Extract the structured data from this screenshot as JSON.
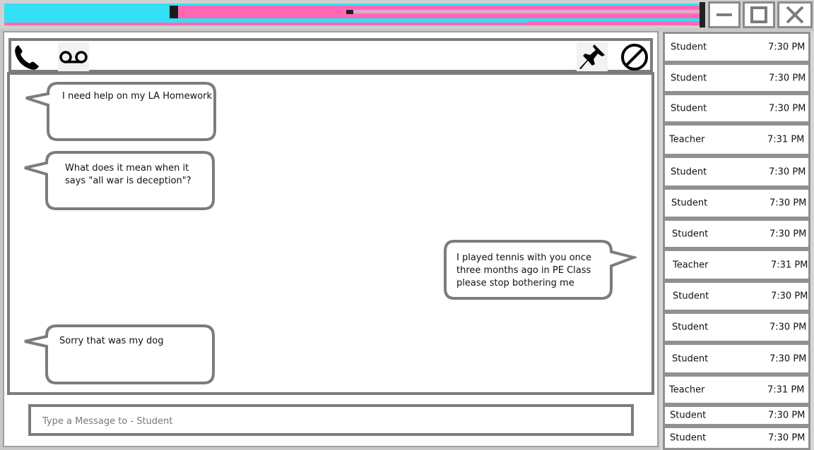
{
  "window": {
    "colors": {
      "cyan": "#33e0f5",
      "pink": "#ff69b4",
      "border": "#7c7c7c"
    },
    "controls": {
      "minimize_icon": "minimize-icon",
      "maximize_icon": "maximize-icon",
      "close_icon": "close-icon"
    }
  },
  "toolbar": {
    "left_icons": [
      "phone-icon",
      "voicemail-icon"
    ],
    "right_icons": [
      "pin-icon",
      "block-icon"
    ]
  },
  "messages": [
    {
      "side": "left",
      "text": "I need help on my LA Homework"
    },
    {
      "side": "left",
      "text": "What does it mean when it\nsays \"all war is deception\"?"
    },
    {
      "side": "right",
      "text": "I played tennis with you once\nthree months ago in PE Class\nplease stop bothering me"
    },
    {
      "side": "left",
      "text": "Sorry that was my dog"
    }
  ],
  "composer": {
    "placeholder": "Type a Message to - Student",
    "value": ""
  },
  "contacts": [
    {
      "name": "Student",
      "time": "7:30 PM"
    },
    {
      "name": "Student",
      "time": "7:30 PM"
    },
    {
      "name": "Student",
      "time": "7:30 PM"
    },
    {
      "name": "Teacher",
      "time": "7:31 PM"
    },
    {
      "name": "Student",
      "time": "7:30 PM"
    },
    {
      "name": "Student",
      "time": "7:30 PM"
    },
    {
      "name": "Student",
      "time": "7:30 PM"
    },
    {
      "name": "Teacher",
      "time": "7:31 PM"
    },
    {
      "name": "Student",
      "time": "7:30 PM"
    },
    {
      "name": "Student",
      "time": "7:30 PM"
    },
    {
      "name": "Student",
      "time": "7:30 PM"
    },
    {
      "name": "Teacher",
      "time": "7:31 PM"
    },
    {
      "name": "Student",
      "time": "7:30 PM"
    },
    {
      "name": "Student",
      "time": "7:30 PM"
    }
  ]
}
